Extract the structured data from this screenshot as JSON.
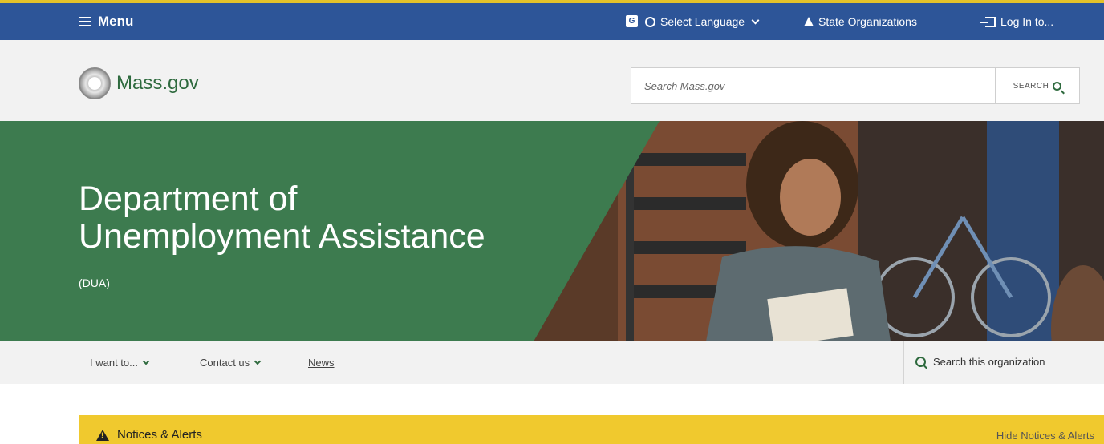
{
  "colors": {
    "topbar": "#2d5598",
    "accent_gold": "#e4c22a",
    "brand_green": "#2e6a3e",
    "banner_green": "#3d7b4f",
    "alert_yellow": "#f0c92e"
  },
  "topbar": {
    "menu_label": "Menu",
    "translate_icon": "translate-icon",
    "language_label": "Select Language",
    "state_orgs_label": "State Organizations",
    "login_label": "Log In to..."
  },
  "header": {
    "logo_text": "Mass.gov",
    "search_placeholder": "Search Mass.gov",
    "search_button": "SEARCH"
  },
  "banner": {
    "title_line1": "Department of",
    "title_line2": "Unemployment Assistance",
    "acronym": "(DUA)"
  },
  "orgnav": {
    "items": [
      "I want to...",
      "Contact us",
      "News"
    ],
    "org_search_label": "Search this organization"
  },
  "alerts": {
    "title": "Notices & Alerts",
    "hide_label": "Hide Notices & Alerts"
  }
}
